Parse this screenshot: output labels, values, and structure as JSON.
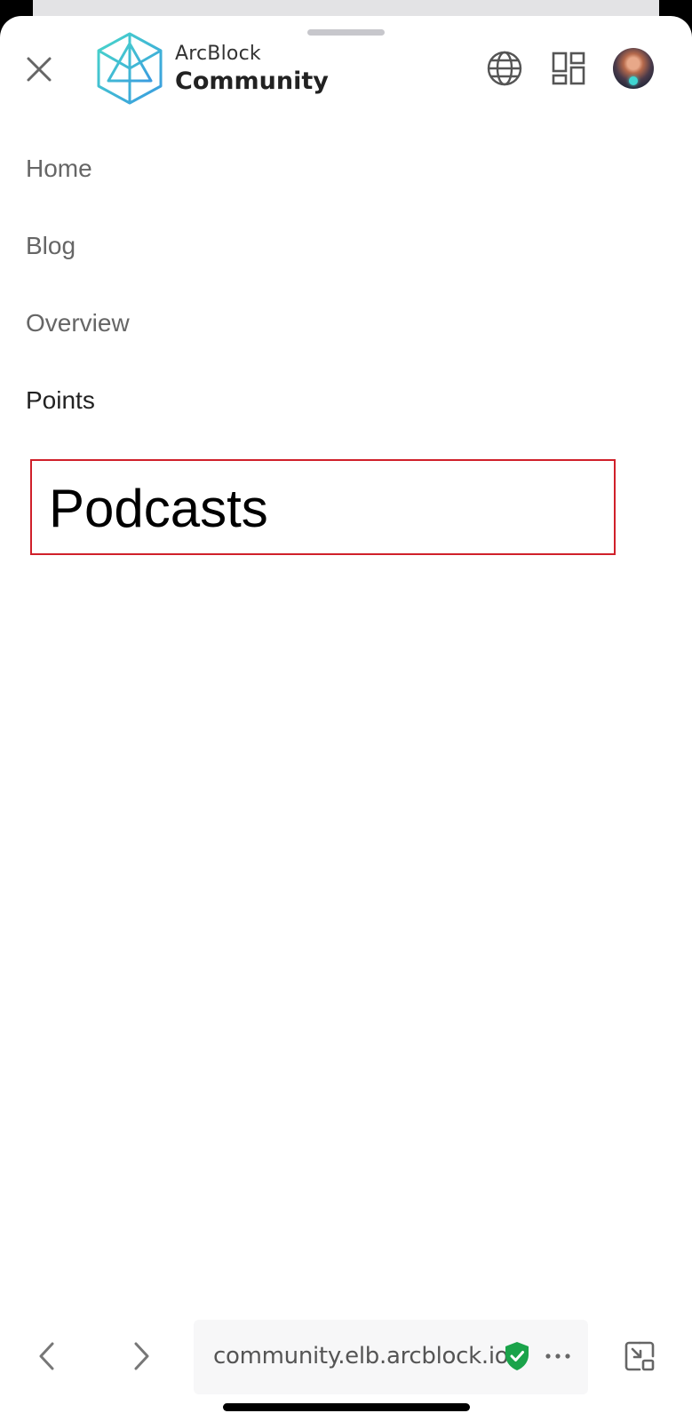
{
  "header": {
    "brand_top": "ArcBlock",
    "brand_main": "Community"
  },
  "menu": {
    "items": [
      {
        "label": "Home"
      },
      {
        "label": "Blog"
      },
      {
        "label": "Overview"
      },
      {
        "label": "Points",
        "active": true
      },
      {
        "label": "Podcasts",
        "highlighted": true
      }
    ]
  },
  "browser": {
    "url": "community.elb.arcblock.io",
    "secure_color": "#1aa34a"
  },
  "icons": {
    "close": "close-icon",
    "logo": "arcblock-logo",
    "globe": "globe-icon",
    "apps": "apps-grid-icon",
    "back": "chevron-left-icon",
    "forward": "chevron-right-icon",
    "more": "more-dots-icon",
    "pip": "picture-in-picture-icon",
    "shield": "shield-check-icon"
  },
  "colors": {
    "highlight_border": "#d0202a",
    "logo_accent": "#3bc3d8"
  }
}
